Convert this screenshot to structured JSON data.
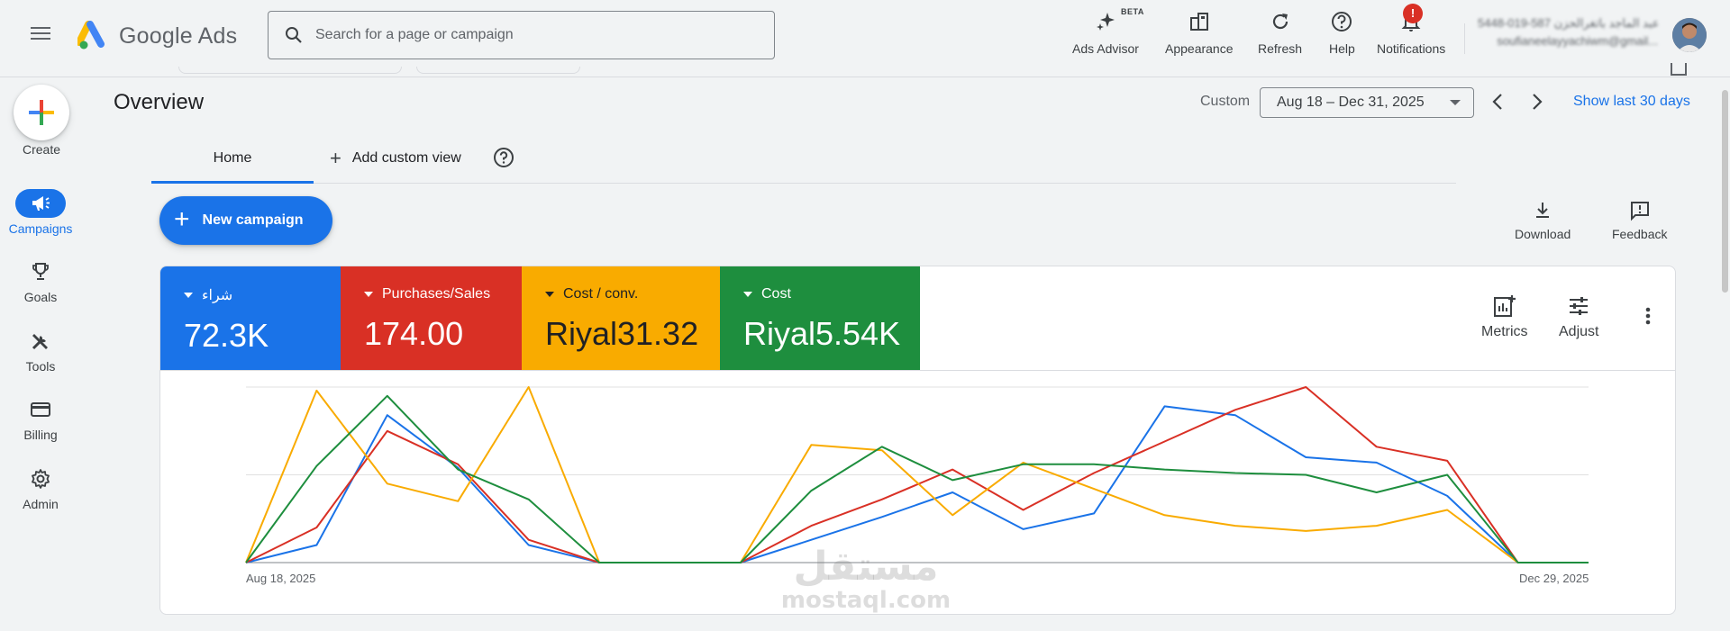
{
  "header": {
    "app_name_part1": "Google",
    "app_name_part2": "Ads",
    "search_placeholder": "Search for a page or campaign",
    "tools": [
      {
        "label": "Ads Advisor",
        "badge": "BETA",
        "icon": "sparkle-icon"
      },
      {
        "label": "Appearance",
        "icon": "appearance-icon"
      },
      {
        "label": "Refresh",
        "icon": "refresh-icon"
      },
      {
        "label": "Help",
        "icon": "help-icon"
      },
      {
        "label": "Notifications",
        "icon": "bell-icon",
        "badge": "!"
      }
    ],
    "account": {
      "line1": "عبد الماجد باتغرالحزن 587-019-5448",
      "line2": "soufianeelayyachiwm@gmail..."
    }
  },
  "leftnav": {
    "create_label": "Create",
    "items": [
      {
        "label": "Campaigns",
        "icon": "megaphone-icon",
        "active": true
      },
      {
        "label": "Goals",
        "icon": "trophy-icon"
      },
      {
        "label": "Tools",
        "icon": "tools-icon"
      },
      {
        "label": "Billing",
        "icon": "credit-card-icon"
      },
      {
        "label": "Admin",
        "icon": "gear-icon"
      }
    ]
  },
  "overview": {
    "title": "Overview",
    "custom_label": "Custom",
    "date_range": "Aug 18 – Dec 31, 2025",
    "show_last": "Show last 30 days"
  },
  "tabs": {
    "home": "Home",
    "add_custom_view": "Add custom view"
  },
  "actions": {
    "new_campaign": "New campaign",
    "download": "Download",
    "feedback": "Feedback"
  },
  "metrics": [
    {
      "name": "شراء",
      "value": "72.3K",
      "color": "#1a73e8"
    },
    {
      "name": "Purchases/Sales",
      "value": "174.00",
      "color": "#d93025"
    },
    {
      "name": "Cost / conv.",
      "value": "Riyal31.32",
      "color": "#f9ab00"
    },
    {
      "name": "Cost",
      "value": "Riyal5.54K",
      "color": "#1e8e3e"
    }
  ],
  "card_tools": {
    "metrics": "Metrics",
    "adjust": "Adjust"
  },
  "watermark": {
    "line1": "مستقل",
    "line2": "mostaql.com"
  },
  "chart_data": {
    "type": "line",
    "x_start_label": "Aug 18, 2025",
    "x_end_label": "Dec 29, 2025",
    "points": 20,
    "grid": true,
    "ylim": [
      0,
      1
    ],
    "series": [
      {
        "name": "شراء",
        "color": "#1a73e8",
        "values": [
          0,
          0.1,
          0.84,
          0.54,
          0.1,
          0,
          0,
          0,
          0.13,
          0.26,
          0.4,
          0.19,
          0.28,
          0.89,
          0.84,
          0.6,
          0.57,
          0.38,
          0,
          0
        ]
      },
      {
        "name": "Purchases/Sales",
        "color": "#d93025",
        "values": [
          0,
          0.2,
          0.75,
          0.56,
          0.13,
          0,
          0,
          0,
          0.21,
          0.36,
          0.53,
          0.3,
          0.51,
          0.69,
          0.87,
          1.0,
          0.66,
          0.58,
          0,
          0
        ]
      },
      {
        "name": "Cost / conv.",
        "color": "#f9ab00",
        "values": [
          0,
          0.98,
          0.45,
          0.35,
          1.0,
          0,
          0,
          0,
          0.67,
          0.64,
          0.27,
          0.57,
          0.42,
          0.27,
          0.21,
          0.18,
          0.21,
          0.3,
          0,
          0
        ]
      },
      {
        "name": "Cost",
        "color": "#1e8e3e",
        "values": [
          0,
          0.55,
          0.95,
          0.53,
          0.36,
          0,
          0,
          0,
          0.41,
          0.66,
          0.47,
          0.56,
          0.56,
          0.53,
          0.51,
          0.5,
          0.4,
          0.5,
          0,
          0
        ]
      }
    ]
  }
}
